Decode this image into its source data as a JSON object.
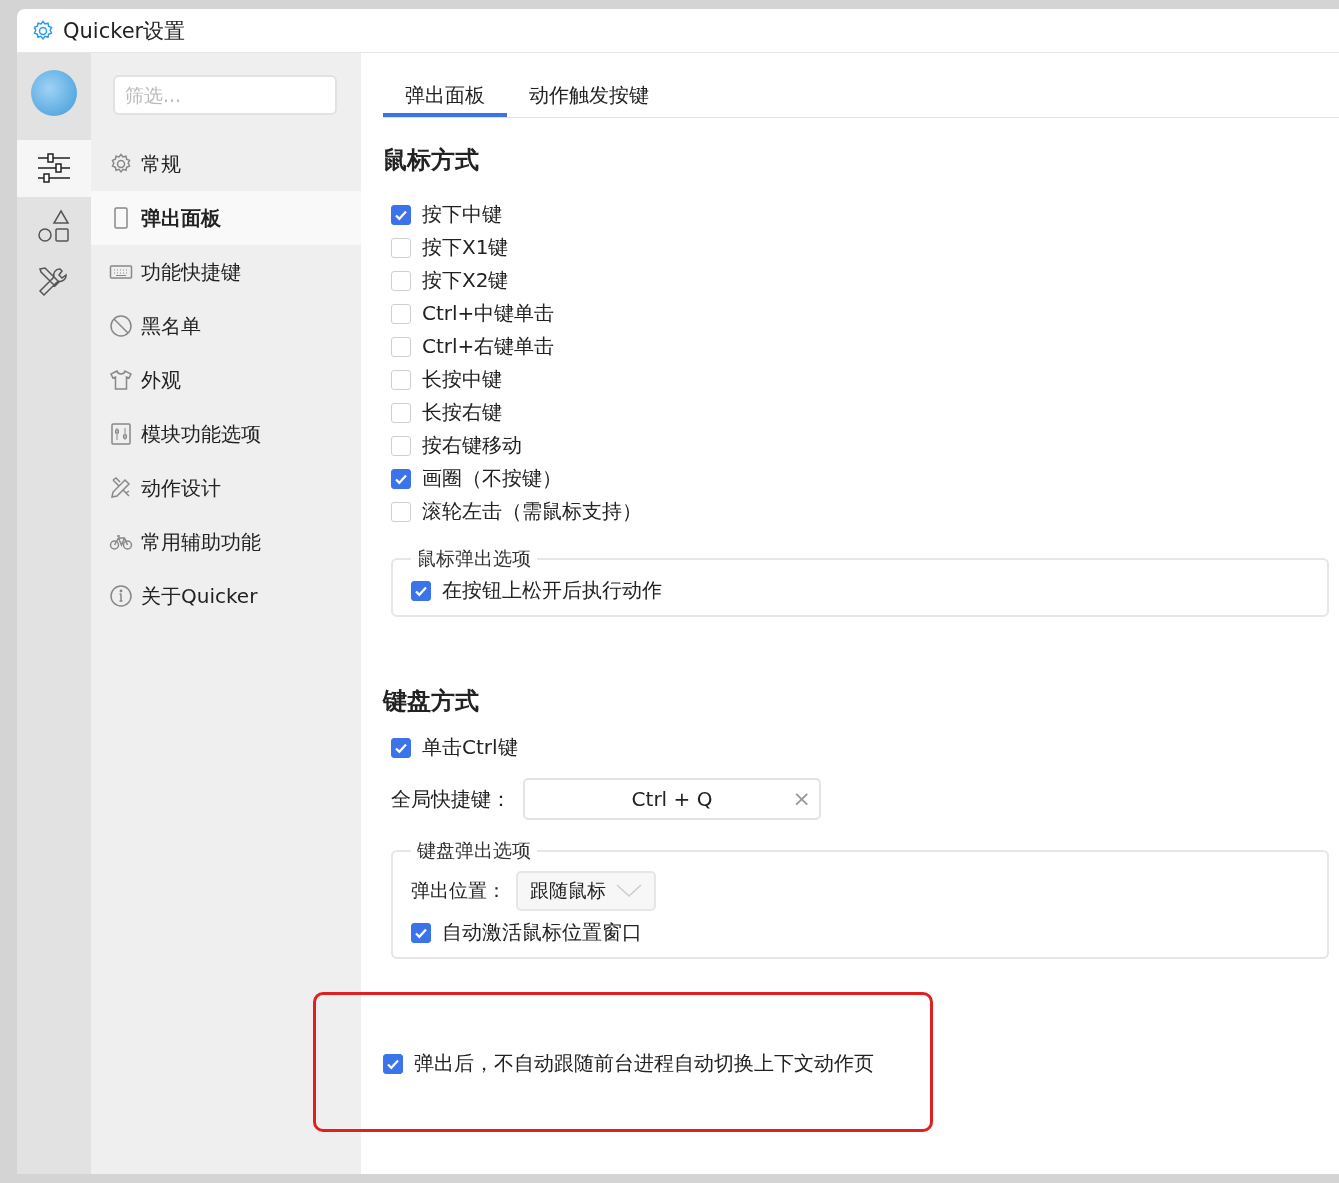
{
  "window": {
    "title": "Quicker设置"
  },
  "rail": [
    {
      "selected": true
    },
    {
      "selected": false
    },
    {
      "selected": false
    }
  ],
  "filter": {
    "placeholder": "筛选..."
  },
  "nav": [
    {
      "label": "常规",
      "selected": false
    },
    {
      "label": "弹出面板",
      "selected": true
    },
    {
      "label": "功能快捷键",
      "selected": false
    },
    {
      "label": "黑名单",
      "selected": false
    },
    {
      "label": "外观",
      "selected": false
    },
    {
      "label": "模块功能选项",
      "selected": false
    },
    {
      "label": "动作设计",
      "selected": false
    },
    {
      "label": "常用辅助功能",
      "selected": false
    },
    {
      "label": "关于Quicker",
      "selected": false
    }
  ],
  "tabs": [
    {
      "label": "弹出面板",
      "selected": true
    },
    {
      "label": "动作触发按键",
      "selected": false
    }
  ],
  "mouse_section": {
    "title": "鼠标方式",
    "options": [
      {
        "label": "按下中键",
        "checked": true
      },
      {
        "label": "按下X1键",
        "checked": false
      },
      {
        "label": "按下X2键",
        "checked": false
      },
      {
        "label": "Ctrl+中键单击",
        "checked": false
      },
      {
        "label": "Ctrl+右键单击",
        "checked": false
      },
      {
        "label": "长按中键",
        "checked": false
      },
      {
        "label": "长按右键",
        "checked": false
      },
      {
        "label": "按右键移动",
        "checked": false
      },
      {
        "label": "画圈（不按键）",
        "checked": true
      },
      {
        "label": "滚轮左击（需鼠标支持）",
        "checked": false
      }
    ],
    "group": {
      "title": "鼠标弹出选项",
      "options": [
        {
          "label": "在按钮上松开后执行动作",
          "checked": true
        }
      ]
    }
  },
  "keyboard_section": {
    "title": "键盘方式",
    "options": [
      {
        "label": "单击Ctrl键",
        "checked": true
      }
    ],
    "hotkey": {
      "label": "全局快捷键：",
      "value": "Ctrl + Q",
      "clear": "×"
    },
    "group": {
      "title": "键盘弹出选项",
      "position": {
        "label": "弹出位置：",
        "value": "跟随鼠标"
      },
      "options": [
        {
          "label": "自动激活鼠标位置窗口",
          "checked": true
        }
      ]
    }
  },
  "extra_options": [
    {
      "label": "弹出后，不自动跟随前台进程自动切换上下文动作页",
      "checked": true
    }
  ]
}
